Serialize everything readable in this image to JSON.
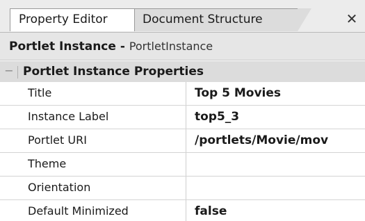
{
  "tabs": [
    {
      "label": "Property Editor",
      "active": true
    },
    {
      "label": "Document Structure",
      "active": false
    }
  ],
  "close_glyph": "✕",
  "instance_header": {
    "title": "Portlet Instance",
    "separator": " - ",
    "type": "PortletInstance"
  },
  "section": {
    "toggle": "−",
    "title": "Portlet Instance Properties"
  },
  "properties": [
    {
      "name": "Title",
      "value": "Top 5 Movies"
    },
    {
      "name": "Instance Label",
      "value": "top5_3"
    },
    {
      "name": "Portlet URI",
      "value": "/portlets/Movie/mov"
    },
    {
      "name": "Theme",
      "value": ""
    },
    {
      "name": "Orientation",
      "value": ""
    },
    {
      "name": "Default Minimized",
      "value": "false"
    }
  ],
  "colors": {
    "tabstrip_bg": "#ececec",
    "header_bg": "#e6e6e6",
    "section_bg": "#dcdcdc",
    "grid_line": "#d4d4d4"
  }
}
